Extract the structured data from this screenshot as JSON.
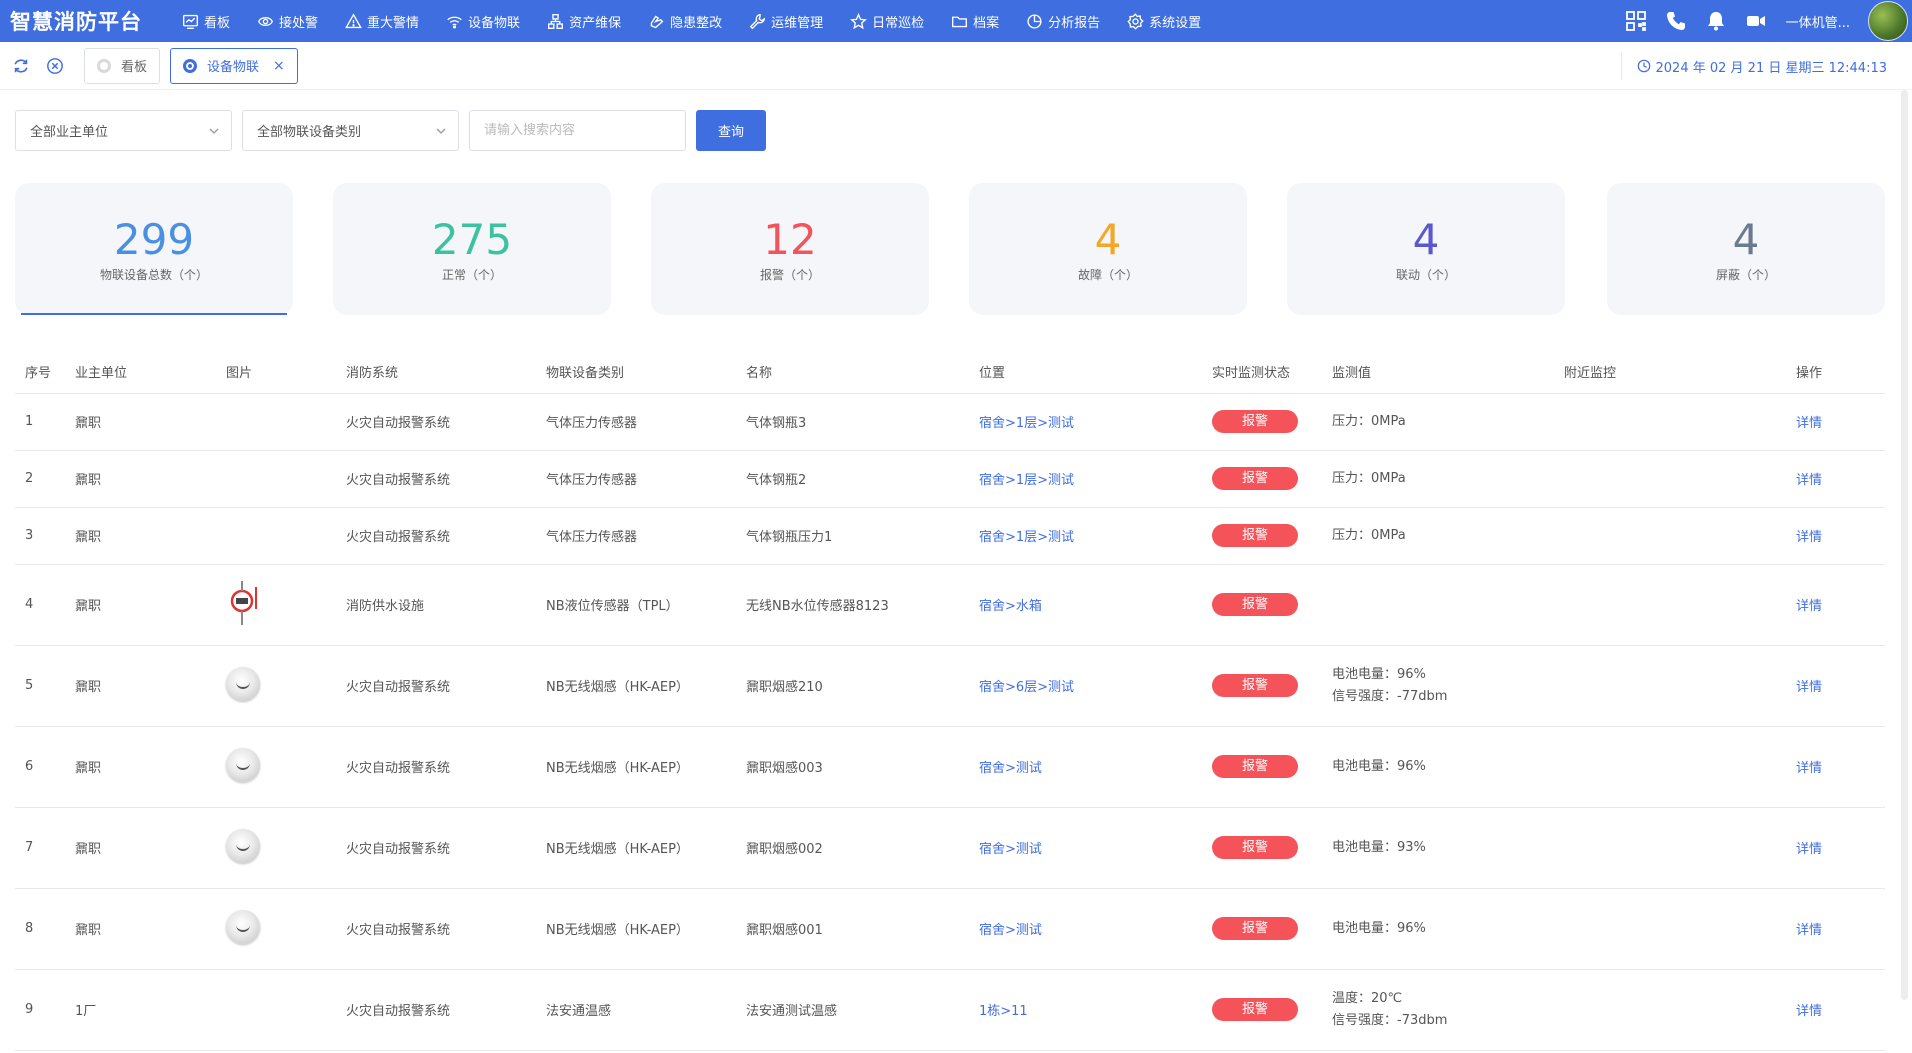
{
  "app": {
    "title": "智慧消防平台"
  },
  "nav": [
    {
      "label": "看板",
      "icon": "chart-line-icon"
    },
    {
      "label": "接处警",
      "icon": "eye-icon"
    },
    {
      "label": "重大警情",
      "icon": "warning-icon"
    },
    {
      "label": "设备物联",
      "icon": "wifi-icon"
    },
    {
      "label": "资产维保",
      "icon": "network-icon"
    },
    {
      "label": "隐患整改",
      "icon": "hand-icon"
    },
    {
      "label": "运维管理",
      "icon": "wrench-icon"
    },
    {
      "label": "日常巡检",
      "icon": "star-icon"
    },
    {
      "label": "档案",
      "icon": "folder-icon"
    },
    {
      "label": "分析报告",
      "icon": "pie-icon"
    },
    {
      "label": "系统设置",
      "icon": "gear-icon"
    }
  ],
  "header_right": {
    "user_name": "一体机管..."
  },
  "tabs": [
    {
      "label": "看板",
      "active": false
    },
    {
      "label": "设备物联",
      "active": true
    }
  ],
  "datetime": "2024 年 02 月 21 日 星期三 12:44:13",
  "filters": {
    "owner_unit": "全部业主单位",
    "device_category": "全部物联设备类别",
    "search_placeholder": "请输入搜索内容",
    "query_label": "查询"
  },
  "stats": [
    {
      "value": "299",
      "label": "物联设备总数（个）",
      "color": "#4a90e2"
    },
    {
      "value": "275",
      "label": "正常（个）",
      "color": "#3cc2a0"
    },
    {
      "value": "12",
      "label": "报警（个）",
      "color": "#f5535a"
    },
    {
      "value": "4",
      "label": "故障（个）",
      "color": "#f5a623"
    },
    {
      "value": "4",
      "label": "联动（个）",
      "color": "#5b57d1"
    },
    {
      "value": "4",
      "label": "屏蔽（个）",
      "color": "#6b7a90"
    }
  ],
  "table": {
    "columns": [
      "序号",
      "业主单位",
      "图片",
      "消防系统",
      "物联设备类别",
      "名称",
      "位置",
      "实时监测状态",
      "监测值",
      "附近监控",
      "操作"
    ],
    "rows": [
      {
        "no": "1",
        "owner": "鼐职",
        "img": "",
        "system": "火灾自动报警系统",
        "category": "气体压力传感器",
        "name": "气体钢瓶3",
        "location": "宿舍>1层>测试",
        "status": "报警",
        "monitor": [
          "压力：0MPa"
        ],
        "nearby": "",
        "action": "详情"
      },
      {
        "no": "2",
        "owner": "鼐职",
        "img": "",
        "system": "火灾自动报警系统",
        "category": "气体压力传感器",
        "name": "气体钢瓶2",
        "location": "宿舍>1层>测试",
        "status": "报警",
        "monitor": [
          "压力：0MPa"
        ],
        "nearby": "",
        "action": "详情"
      },
      {
        "no": "3",
        "owner": "鼐职",
        "img": "",
        "system": "火灾自动报警系统",
        "category": "气体压力传感器",
        "name": "气体钢瓶压力1",
        "location": "宿舍>1层>测试",
        "status": "报警",
        "monitor": [
          "压力：0MPa"
        ],
        "nearby": "",
        "action": "详情"
      },
      {
        "no": "4",
        "owner": "鼐职",
        "img": "level-sensor",
        "system": "消防供水设施",
        "category": "NB液位传感器（TPL）",
        "name": "无线NB水位传感器8123",
        "location": "宿舍>水箱",
        "status": "报警",
        "monitor": [],
        "nearby": "",
        "action": "详情"
      },
      {
        "no": "5",
        "owner": "鼐职",
        "img": "smoke-detector",
        "system": "火灾自动报警系统",
        "category": "NB无线烟感（HK-AEP）",
        "name": "鼐职烟感210",
        "location": "宿舍>6层>测试",
        "status": "报警",
        "monitor": [
          "电池电量：96%",
          "信号强度：-77dbm"
        ],
        "nearby": "",
        "action": "详情"
      },
      {
        "no": "6",
        "owner": "鼐职",
        "img": "smoke-detector",
        "system": "火灾自动报警系统",
        "category": "NB无线烟感（HK-AEP）",
        "name": "鼐职烟感003",
        "location": "宿舍>测试",
        "status": "报警",
        "monitor": [
          "电池电量：96%"
        ],
        "nearby": "",
        "action": "详情"
      },
      {
        "no": "7",
        "owner": "鼐职",
        "img": "smoke-detector",
        "system": "火灾自动报警系统",
        "category": "NB无线烟感（HK-AEP）",
        "name": "鼐职烟感002",
        "location": "宿舍>测试",
        "status": "报警",
        "monitor": [
          "电池电量：93%"
        ],
        "nearby": "",
        "action": "详情"
      },
      {
        "no": "8",
        "owner": "鼐职",
        "img": "smoke-detector",
        "system": "火灾自动报警系统",
        "category": "NB无线烟感（HK-AEP）",
        "name": "鼐职烟感001",
        "location": "宿舍>测试",
        "status": "报警",
        "monitor": [
          "电池电量：96%"
        ],
        "nearby": "",
        "action": "详情"
      },
      {
        "no": "9",
        "owner": "1厂",
        "img": "",
        "system": "火灾自动报警系统",
        "category": "法安通温感",
        "name": "法安通测试温感",
        "location": "1栋>11",
        "status": "报警",
        "monitor": [
          "温度：20℃",
          "信号强度：-73dbm"
        ],
        "nearby": "",
        "action": "详情"
      }
    ]
  },
  "colors": {
    "primary": "#3f6ee0",
    "alarm": "#f5535a",
    "card_bg": "#f5f6f9"
  }
}
